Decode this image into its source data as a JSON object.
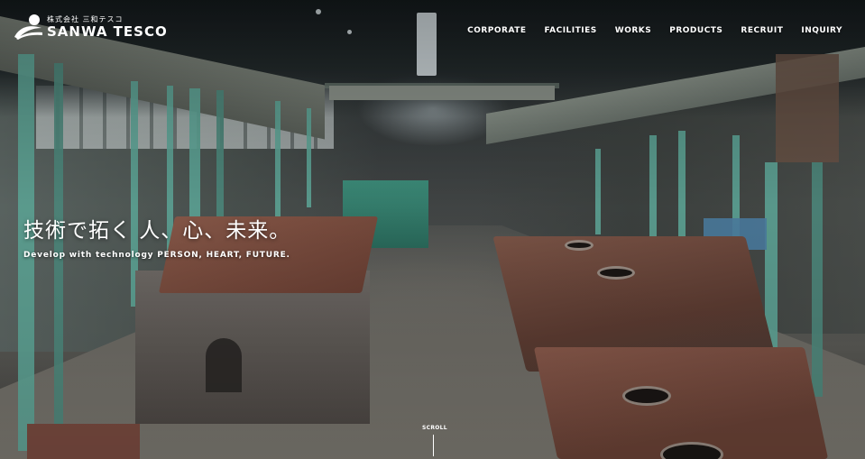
{
  "brand": {
    "name_jp": "株式会社 三和テスコ",
    "name_en": "SANWA TESCO",
    "logo_icon": "sanwa-tesco-logo-icon"
  },
  "nav": {
    "items": [
      {
        "label": "CORPORATE"
      },
      {
        "label": "FACILITIES"
      },
      {
        "label": "WORKS"
      },
      {
        "label": "PRODUCTS"
      },
      {
        "label": "RECRUIT"
      },
      {
        "label": "INQUIRY"
      }
    ]
  },
  "hero": {
    "tagline": "技術で拓く 人、心、未来。",
    "subline": "Develop with technology PERSON, HEART, FUTURE.",
    "scroll_label": "SCROLL"
  },
  "colors": {
    "text": "#ffffff",
    "steel_green": "#5fa89a",
    "rust": "#7e5648"
  }
}
